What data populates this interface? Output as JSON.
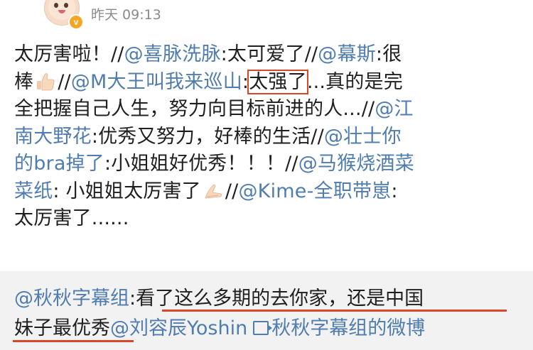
{
  "post": {
    "timestamp": "昨天 09:13",
    "verified_mark": "v",
    "lines": [
      {
        "t1": "太厉害啦！//",
        "m1": "@喜脉洗脉",
        "t2": ":太可爱了//",
        "m2": "@幕斯",
        "t3": ":很"
      },
      {
        "t1": "棒",
        "t2": "//",
        "m1": "@M大王叫我来巡山",
        "t3": ":",
        "boxed": "太强了",
        "t4": "...真的是完"
      },
      {
        "t1": "全把握自己人生，努力向目标前进的人...//",
        "m1": "@江"
      },
      {
        "m1": "南大野花",
        "t1": ":优秀又努力，好棒的生活//",
        "m2": "@壮士你"
      },
      {
        "m1": "的bra掉了",
        "t1": ":小姐姐好优秀！！！//",
        "m2": "@马猴烧酒菜"
      },
      {
        "m1": "菜纸",
        "t1": ": 小姐姐太厉害了",
        "t2": "//",
        "m2": "@Kime-全职带崽",
        "t3": ":"
      },
      {
        "t1": "太厉害了......"
      }
    ],
    "emojis": [
      "thumbs-up",
      "pray"
    ]
  },
  "repost": {
    "line1": {
      "m1": "@秋秋字幕组",
      "t1": ":看了这么多期的去你家，还是中国"
    },
    "line2": {
      "t1": "妹子最优秀",
      "m1": "@刘容辰Yoshin",
      "m2": "秋秋字幕组的微博"
    }
  },
  "colors": {
    "mention": "#507daf",
    "highlight": "#d9472b",
    "repost_bg": "#f2f2f2",
    "timestamp": "#8a8a8a"
  }
}
